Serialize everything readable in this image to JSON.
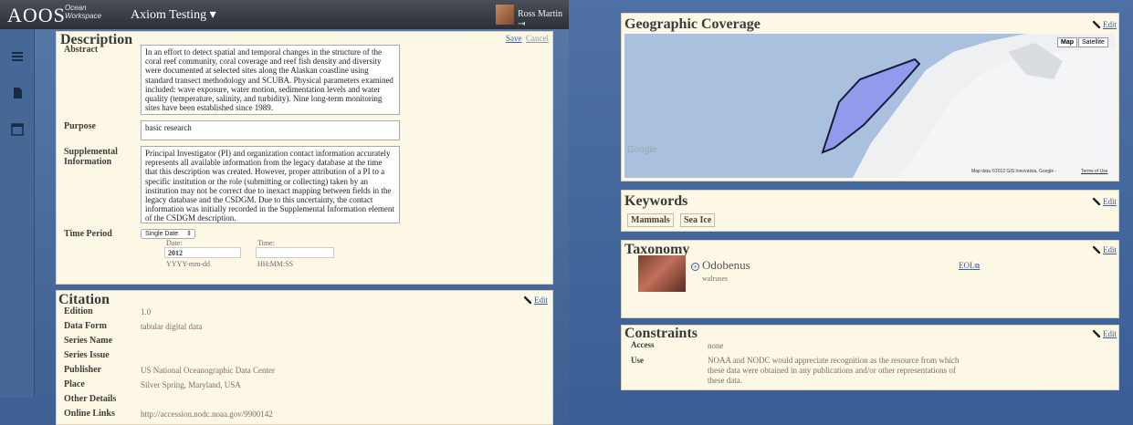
{
  "left": {
    "app": {
      "logo": "AOOS",
      "logo_sub_1": "Ocean",
      "logo_sub_2": "Workspace",
      "project": "Axiom Testing ▾",
      "user": "Ross Martin ⇥"
    },
    "description": {
      "title": "Description",
      "save": "Save",
      "cancel": "Cancel",
      "abstract_label": "Abstract",
      "abstract": "In an effort to detect spatial and temporal changes in the structure of the coral reef community, coral coverage and reef fish density and diversity were documented at selected sites along the Alaskan coastline using standard transect methodology and SCUBA. Physical parameters examined included: wave exposure, water motion, sedimentation levels and water quality (temperature, salinity, and turbidity). Nine long-term monitoring sites have been established since 1989.",
      "purpose_label": "Purpose",
      "purpose": "basic research",
      "supplemental_label_1": "Supplemental",
      "supplemental_label_2": "Information",
      "supplemental": "Principal Investigator (PI) and organization contact information accurately represents all available information from the legacy database at the time that this description was created. However, proper attribution of a PI to a specific institution or the role (submitting or collecting) taken by an institution may not be correct due to inexact mapping between fields in the legacy database and the CSDGM. Due to this uncertainty, the contact information was initially recorded in the Supplemental Information element of the CSDGM description.",
      "time_label": "Time Period",
      "time_select": "Single Date",
      "date_label": "Date:",
      "date_value": "2012",
      "date_hint": "YYYY-mm-dd",
      "time_field_label": "Time:",
      "time_hint": "HH:MM:SS"
    },
    "citation": {
      "title": "Citation",
      "edit": "Edit",
      "rows": [
        {
          "label": "Edition",
          "value": "1.0"
        },
        {
          "label": "Data Form",
          "value": "tabular digital data"
        },
        {
          "label": "Series Name",
          "value": ""
        },
        {
          "label": "Series Issue",
          "value": ""
        },
        {
          "label": "Publisher",
          "value": "US National Oceanographic Data Center"
        },
        {
          "label": "Place",
          "value": "Silver Spring, Maryland, USA"
        },
        {
          "label": "Other Details",
          "value": ""
        },
        {
          "label": "Online Links",
          "value": "http://accession.nodc.noaa.gov/9900142"
        }
      ]
    }
  },
  "right": {
    "geo": {
      "title": "Geographic Coverage",
      "edit": "Edit",
      "map_btn": "Map",
      "sat_btn": "Satellite",
      "google": "Google",
      "attribution": "Map data ©2012 GIS Innovatsia, Google -",
      "terms": "Terms of Use"
    },
    "keywords": {
      "title": "Keywords",
      "edit": "Edit",
      "items": [
        "Mammals",
        "Sea Ice"
      ]
    },
    "taxonomy": {
      "title": "Taxonomy",
      "edit": "Edit",
      "name": "Odobenus",
      "common": "walruses",
      "eol": "EOL"
    },
    "constraints": {
      "title": "Constraints",
      "edit": "Edit",
      "access_label": "Access",
      "access": "none",
      "use_label": "Use",
      "use": "NOAA and NODC would appreciate recognition as the resource from which these data were obtained in any publications and/or other representations of these data."
    }
  },
  "colors": {
    "panel": "#fdf7e5",
    "link": "#3b5ea0",
    "topbar": "#2b2f36",
    "nav_bg": "#456896",
    "polygon": "#8a8ff0"
  },
  "icons": [
    "menu-icon",
    "document-icon",
    "window-icon",
    "pencil-icon",
    "external-link-icon",
    "plus-icon"
  ]
}
